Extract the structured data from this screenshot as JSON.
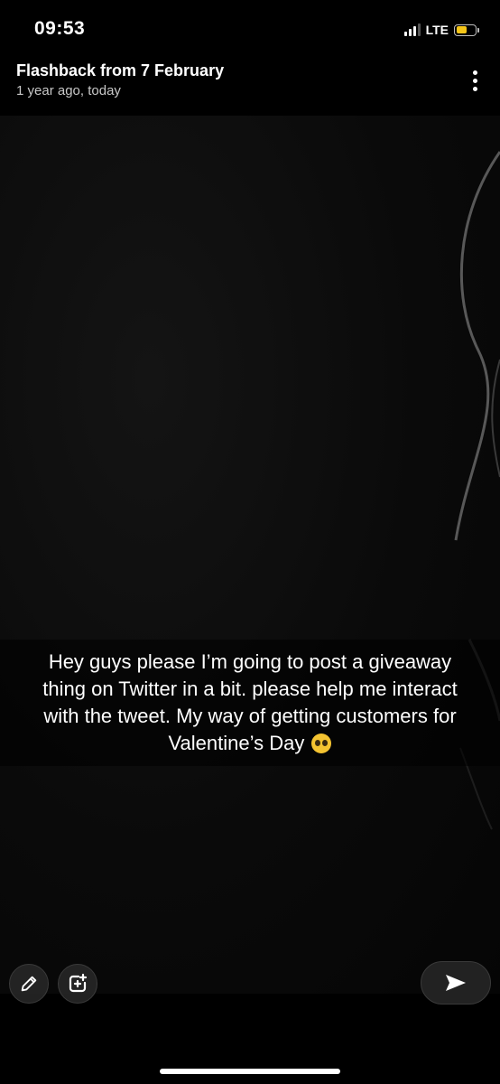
{
  "status_bar": {
    "time": "09:53",
    "network": "LTE",
    "battery_level": 0.6,
    "battery_color": "#f5c518"
  },
  "header": {
    "title": "Flashback from 7 February",
    "subtitle": "1 year ago, today",
    "more_icon": "more-vertical-icon"
  },
  "snap": {
    "caption": "Hey guys please I’m going to post a giveaway thing on Twitter in a bit. please help me interact with the tweet. My way of getting customers for Valentine’s Day",
    "caption_emoji": "pleading-face-emoji"
  },
  "toolbar": {
    "pencil_icon": "pencil-icon",
    "sticker_icon": "add-sticker-icon",
    "send_icon": "send-arrow-icon"
  }
}
